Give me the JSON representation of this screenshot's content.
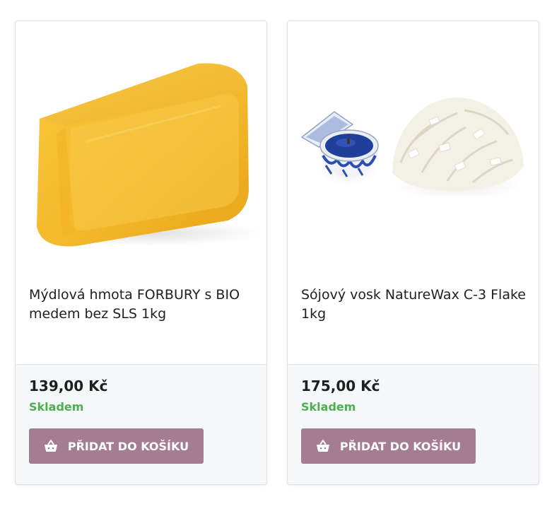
{
  "products": [
    {
      "name": "Mýdlová hmota FORBURY s BIO medem bez SLS 1kg",
      "price": "139,00 Kč",
      "stock": "Skladem",
      "button_label": "PŘIDAT DO KOŠÍKU",
      "image": "yellow-glycerin-soap-block"
    },
    {
      "name": "Sójový vosk NatureWax C-3 Flake 1kg",
      "price": "175,00 Kč",
      "stock": "Skladem",
      "button_label": "PŘIDAT DO KOŠÍKU",
      "image": "soy-wax-flakes-with-candle-tin"
    }
  ],
  "colors": {
    "button": "#a47d92",
    "stock": "#4caf50",
    "footer_bg": "#f6f7f9"
  },
  "icons": {
    "cart": "basket-icon"
  }
}
